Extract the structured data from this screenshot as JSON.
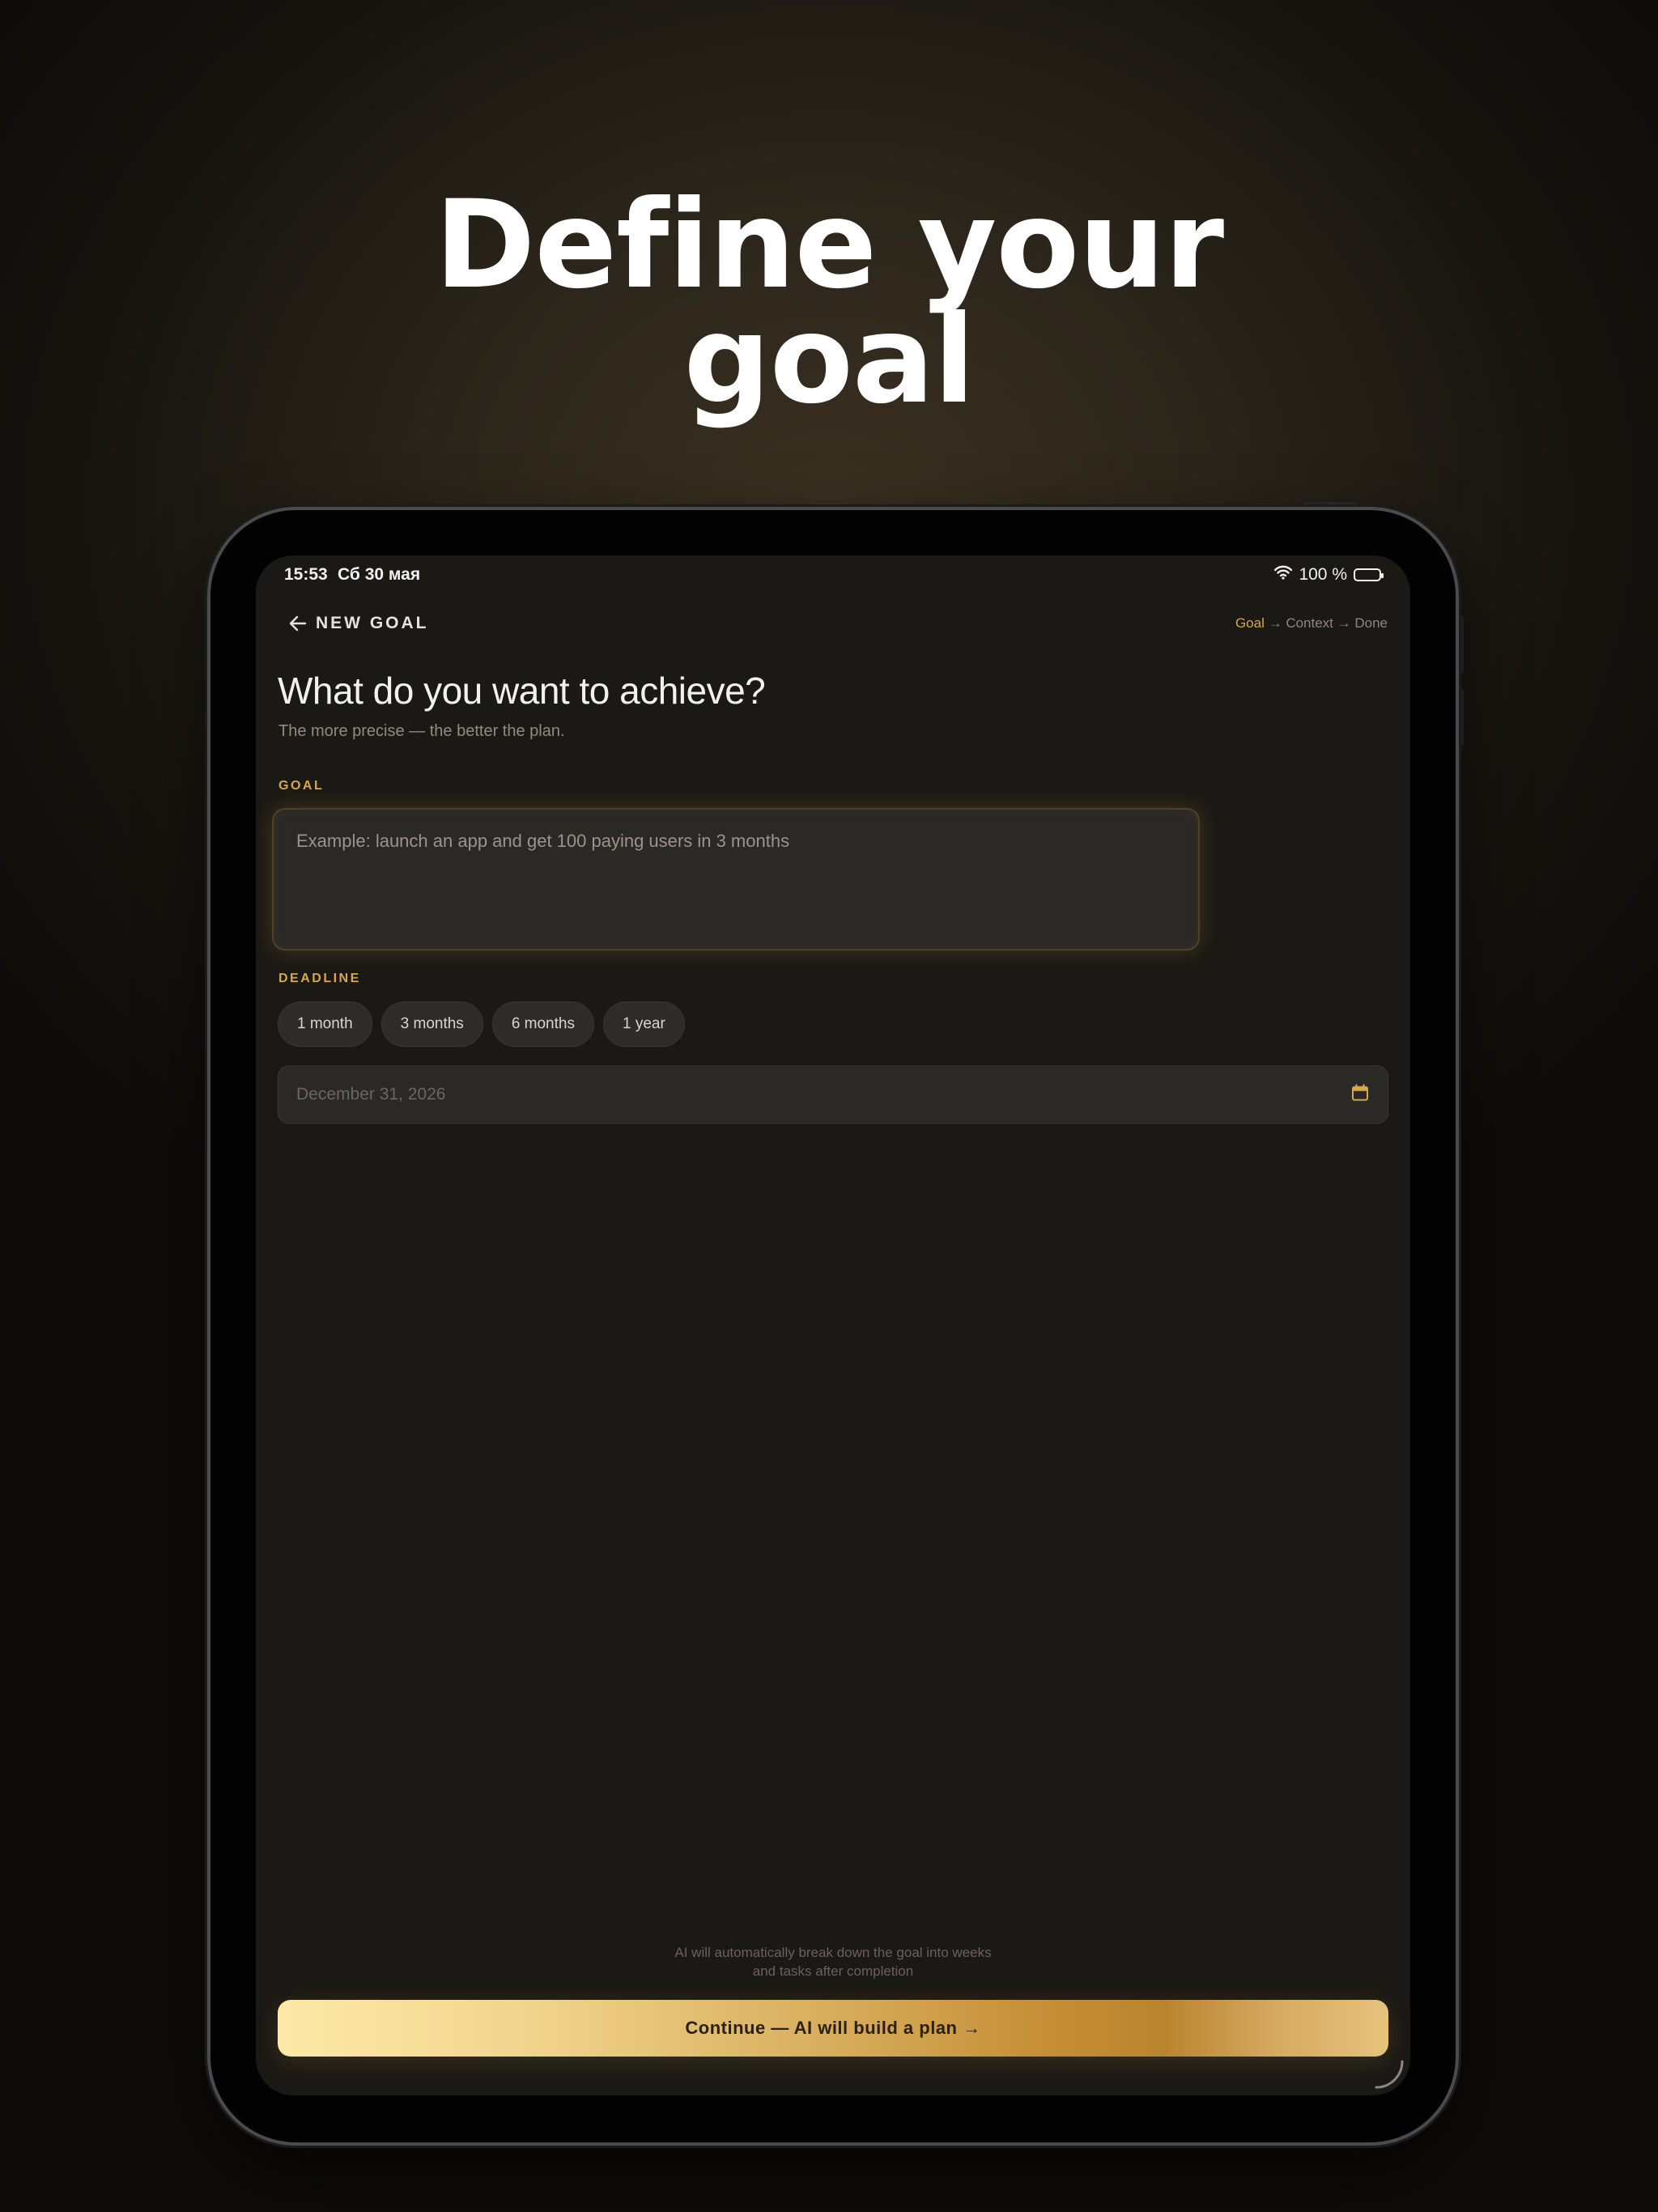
{
  "hero": {
    "line1": "Define your",
    "line2": "goal"
  },
  "status_bar": {
    "time": "15:53",
    "date": "Сб 30 мая",
    "battery": "100 %"
  },
  "header": {
    "title": "NEW GOAL",
    "steps": {
      "current": "Goal",
      "rest": " → Context → Done"
    }
  },
  "main": {
    "heading": "What do you want to achieve?",
    "subtitle": "The more precise — the better the plan.",
    "goal_label": "GOAL",
    "goal_placeholder": "Example: launch an app and get 100 paying users in 3 months",
    "deadline_label": "DEADLINE",
    "deadline_options": [
      "1 month",
      "3 months",
      "6 months",
      "1 year"
    ],
    "date_placeholder": "December 31, 2026"
  },
  "footer": {
    "hint_line1": "AI will automatically break down the goal into weeks",
    "hint_line2": "and tasks after completion",
    "cta_label": "Continue — AI will build a plan →"
  },
  "colors": {
    "accent": "#d5a84f",
    "background": "#1b1915",
    "text": "#f3f1ec"
  }
}
